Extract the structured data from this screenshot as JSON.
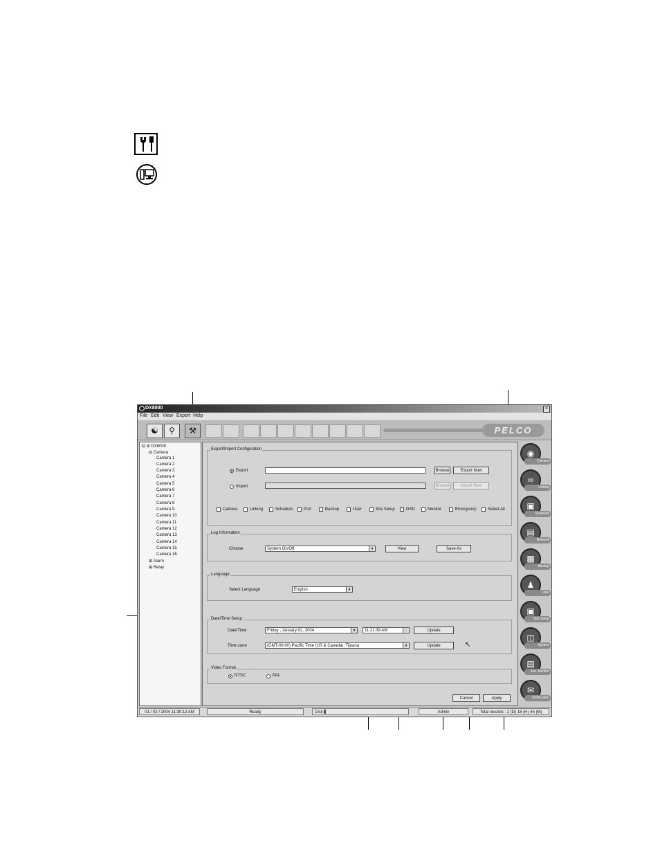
{
  "window": {
    "title": "DX8000",
    "close": "×"
  },
  "menu": [
    "File",
    "Edit",
    "View",
    "Export",
    "Help"
  ],
  "brand": "PELCO",
  "tree": {
    "root": "DX8000",
    "camera_group": "Camera",
    "cameras": [
      "Camera 1",
      "Camera 2",
      "Camera 3",
      "Camera 4",
      "Camera 5",
      "Camera 6",
      "Camera 7",
      "Camera 8",
      "Camera 9",
      "Camera 10",
      "Camera 11",
      "Camera 12",
      "Camera 13",
      "Camera 14",
      "Camera 15",
      "Camera 16"
    ],
    "alarm": "Alarm",
    "relay": "Relay"
  },
  "export_import": {
    "title": "Export/Import Configuration",
    "export_label": "Export",
    "import_label": "Import",
    "browse": "Browse",
    "export_now": "Export Now",
    "import_now": "Import Now",
    "checks": [
      "Camera",
      "Linking",
      "Schedule",
      "Port",
      "Backup",
      "User",
      "Site Setup",
      "DSD",
      "Monitor",
      "Emergency",
      "Select All"
    ]
  },
  "log": {
    "title": "Log Information",
    "choose_label": "Choose",
    "choose_value": "System On/Off",
    "view": "View",
    "save_as": "Save As"
  },
  "language": {
    "title": "Language",
    "select_label": "Select Language",
    "value": "English"
  },
  "datetime": {
    "title": "Date/Time Setup",
    "date_label": "Date/Time",
    "date_value": "Friday   ,  January  02, 2004",
    "time_value": "11:21:39 AM",
    "update": "Update",
    "tz_label": "Time zone",
    "tz_value": "(GMT-08:00) Pacific Time (US & Canada); Tijuana"
  },
  "video": {
    "title": "Video Format",
    "ntsc": "NTSC",
    "pal": "PAL"
  },
  "actions": {
    "cancel": "Cancel",
    "apply": "Apply"
  },
  "sidebar": [
    "Camera",
    "Linking",
    "Schedule",
    "Network",
    "Backup",
    "User",
    "Site Setup",
    "System",
    "Ext. Monitor",
    "Notification"
  ],
  "status": {
    "datetime": "01 / 02 / 2004  11:30:12 AM",
    "ready": "Ready",
    "disk": "Disk",
    "user": "Admin",
    "records": "Total records : 2 (D) 18 (H) 45 (M)"
  }
}
